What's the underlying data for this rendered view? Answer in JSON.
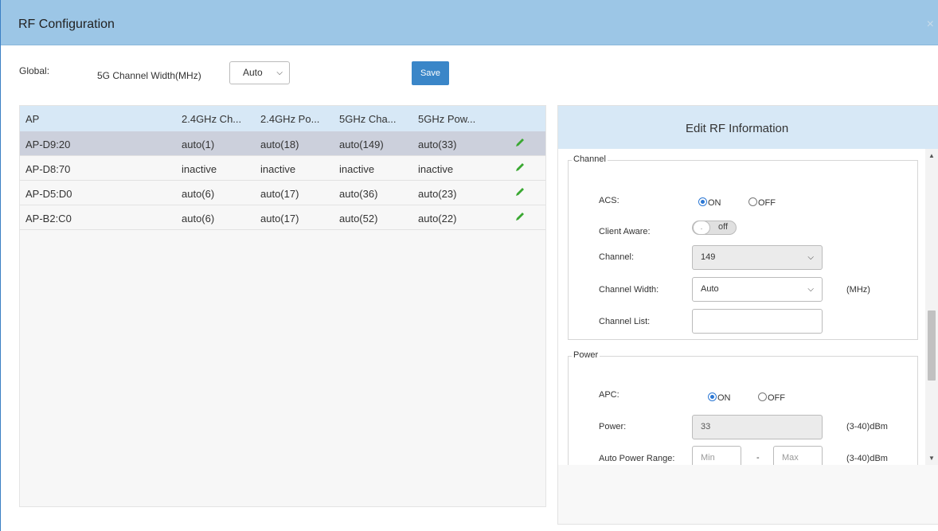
{
  "dialog": {
    "title": "RF Configuration",
    "close_glyph": "×"
  },
  "global": {
    "label": "Global:",
    "channel_width_label": "5G Channel Width(MHz)",
    "channel_width_value": "Auto",
    "save_label": "Save"
  },
  "ap_table": {
    "headers": [
      "AP",
      "2.4GHz Ch...",
      "2.4GHz Po...",
      "5GHz Cha...",
      "5GHz Pow..."
    ],
    "rows": [
      {
        "ap": "AP-D9:20",
        "ch24": "auto(1)",
        "pw24": "auto(18)",
        "ch5": "auto(149)",
        "pw5": "auto(33)"
      },
      {
        "ap": "AP-D8:70",
        "ch24": "inactive",
        "pw24": "inactive",
        "ch5": "inactive",
        "pw5": "inactive"
      },
      {
        "ap": "AP-D5:D0",
        "ch24": "auto(6)",
        "pw24": "auto(17)",
        "ch5": "auto(36)",
        "pw5": "auto(23)"
      },
      {
        "ap": "AP-B2:C0",
        "ch24": "auto(6)",
        "pw24": "auto(17)",
        "ch5": "auto(52)",
        "pw5": "auto(22)"
      }
    ],
    "selected_row": 0,
    "edit_icon": "pencil-icon"
  },
  "edit_rf": {
    "title": "Edit RF Information",
    "channel_section": {
      "legend": "Channel",
      "acs_label": "ACS:",
      "acs_on_label": "ON",
      "acs_off_label": "OFF",
      "acs_value": "ON",
      "client_aware_label": "Client Aware:",
      "client_aware_knob": ".",
      "client_aware_state": "off",
      "channel_label": "Channel:",
      "channel_value": "149",
      "channel_width_label": "Channel Width:",
      "channel_width_value": "Auto",
      "channel_width_unit": "(MHz)",
      "channel_list_label": "Channel List:",
      "channel_list_value": ""
    },
    "power_section": {
      "legend": "Power",
      "apc_label": "APC:",
      "apc_on_label": "ON",
      "apc_off_label": "OFF",
      "apc_value": "ON",
      "power_label": "Power:",
      "power_value": "33",
      "power_unit": "(3-40)dBm",
      "auto_range_label": "Auto Power Range:",
      "min_placeholder": "Min",
      "range_separator": "-",
      "max_placeholder": "Max",
      "range_unit": "(3-40)dBm"
    }
  },
  "colors": {
    "header_bg": "#9cc6e6",
    "table_header_bg": "#d7e8f6",
    "selected_row_bg": "#ccd0dc",
    "save_button_bg": "#3a86c8",
    "edit_icon": "#3aa832",
    "radio_on": "#2b77d4"
  }
}
